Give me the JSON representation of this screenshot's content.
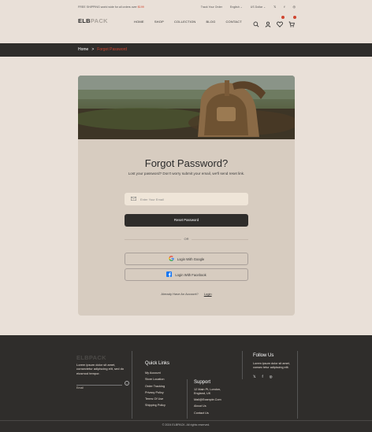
{
  "topbar": {
    "promo_prefix": "FREE SHIPPING world wide for all orders over",
    "promo_code": "$199",
    "track_order": "Track Your Order",
    "language": "English",
    "currency": "US Dollar"
  },
  "header": {
    "logo_main": "ELB",
    "logo_sub": "PACK",
    "nav": [
      "HOME",
      "SHOP",
      "COLLECTION",
      "BLOG",
      "CONTACT"
    ]
  },
  "breadcrumb": {
    "home": "Home",
    "separator": ">",
    "current": "Forgot Password"
  },
  "card": {
    "title": "Forgot Password?",
    "description": "Lost your password? Don't worry submit your email, we'll send reset link.",
    "email_placeholder": "Enter Your Email",
    "reset_label": "Reset Password",
    "or_label": "OR",
    "google_label": "Login With Google",
    "facebook_label": "Login With Facebook",
    "account_prompt": "Already Have An Account?",
    "login_label": "Login"
  },
  "footer": {
    "logo_main": "ELB",
    "logo_sub": "PACK",
    "about": "Lorem ipsum dolor sit amet, consectetur adipiscing elit, sed do eiusmod tempor.",
    "email_label": "Email",
    "quick_links_title": "Quick Links",
    "quick_links": [
      "My Account",
      "Store Location",
      "Order Tracking",
      "Privacy Policy",
      "Terms Of Use",
      "Shipping Policy"
    ],
    "support_title": "Support",
    "support_address": "12 Main Pt, London, England, UK",
    "support_items": [
      "Mail@Example.Com",
      "About Us",
      "Contact Us"
    ],
    "follow_title": "Follow Us",
    "follow_text": "Lorem ipsum dolor sit amet, consec tetur adipiscing elit.",
    "copyright": "© 2024 ELBPACK. All rights reserved."
  },
  "colors": {
    "background": "#e9e0d8",
    "dark": "#2f2d2b",
    "accent": "#d0452f",
    "card": "#d7ccc0"
  }
}
